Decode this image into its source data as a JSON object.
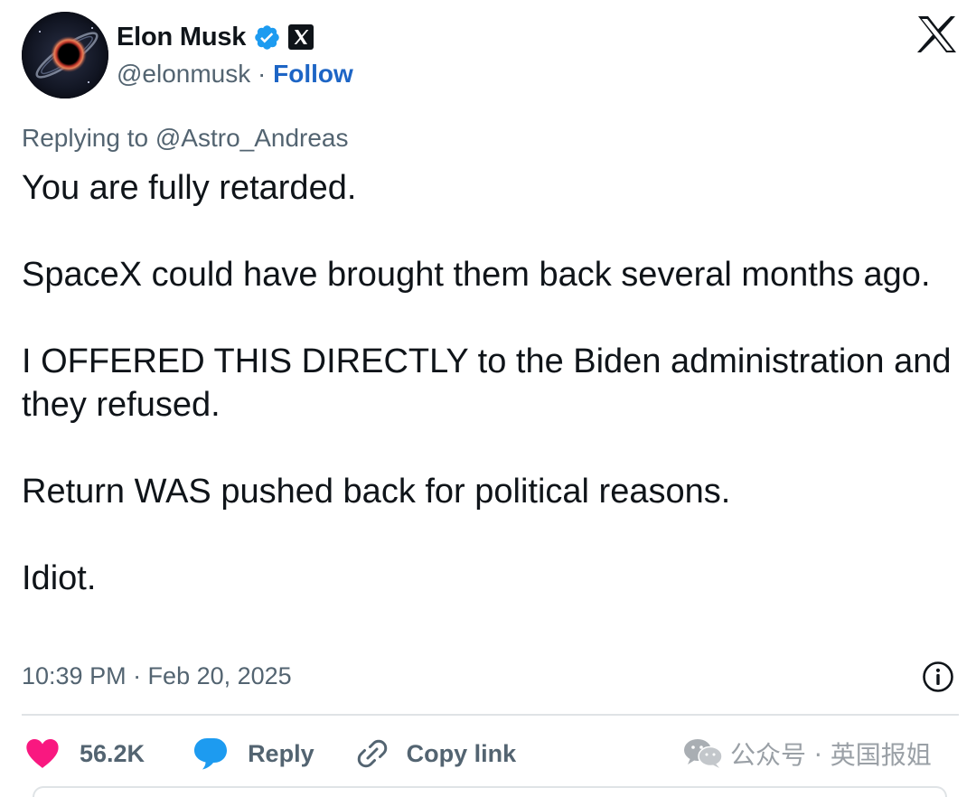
{
  "author": {
    "name": "Elon Musk",
    "handle": "@elonmusk",
    "separator": " · ",
    "follow_label": "Follow"
  },
  "reply_context": "Replying to @Astro_Andreas",
  "tweet": {
    "paragraphs": [
      "You are fully retarded.",
      "SpaceX could have brought them back several months ago.",
      "I OFFERED THIS DIRECTLY to the Biden administration and they refused.",
      "Return WAS pushed back for political reasons.",
      "Idiot."
    ],
    "timestamp": "10:39 PM · Feb 20, 2025"
  },
  "actions": {
    "like_count": "56.2K",
    "reply_label": "Reply",
    "copy_link_label": "Copy link"
  },
  "watermark": "公众号 · 英国报姐",
  "icons": {
    "verified": "verified-badge-icon",
    "org": "x-affiliation-badge-icon",
    "brand": "x-logo-icon",
    "info": "info-icon",
    "like": "heart-icon",
    "reply": "reply-bubble-icon",
    "copy": "link-icon",
    "watermark": "wechat-icon"
  },
  "colors": {
    "follow": "#1d65c5",
    "verified": "#1d9bf0",
    "like": "#f91880",
    "reply": "#1d9bf0",
    "secondary_text": "#536471"
  }
}
